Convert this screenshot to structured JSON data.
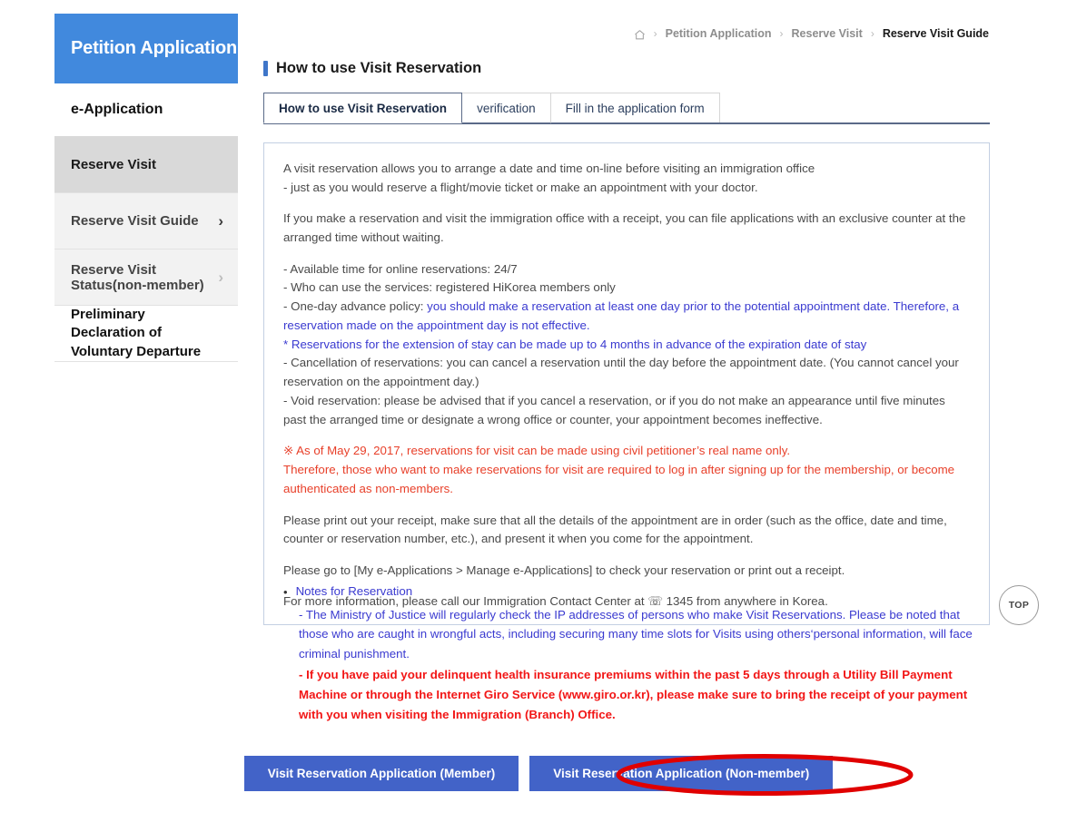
{
  "sidebar": {
    "header_title": "Petition Application",
    "section_title": "e-Application",
    "items": [
      {
        "label": "Reserve Visit",
        "chevron": ""
      },
      {
        "label": "Reserve Visit Guide",
        "chevron": "›"
      },
      {
        "label": "Reserve Visit Status(non-member)",
        "chevron": "›"
      },
      {
        "label": "Preliminary Declaration of Voluntary Departure",
        "chevron": ""
      }
    ]
  },
  "breadcrumb": {
    "home_icon": "home-icon",
    "separator": "›",
    "items": [
      "Petition Application",
      "Reserve Visit",
      "Reserve Visit Guide"
    ]
  },
  "page": {
    "title": "How to use Visit Reservation"
  },
  "tabs": [
    {
      "label": "How to use Visit Reservation",
      "active": true
    },
    {
      "label": "verification",
      "active": false
    },
    {
      "label": "Fill in the application form",
      "active": false
    }
  ],
  "info_box": {
    "para1_line1": "A visit reservation allows you to arrange a date and time on-line before visiting an immigration office",
    "para1_line2": "- just as you would reserve a flight/movie ticket or make an appointment with your doctor.",
    "para2": "If you make a reservation and visit the immigration office with a receipt, you can file applications with an exclusive counter at the arranged time without waiting.",
    "bullet_available": "- Available time for online reservations: 24/7",
    "bullet_who": "- Who can use the services: registered HiKorea members only",
    "bullet_oneday_prefix": "- One-day advance policy: ",
    "bullet_oneday_blue": "you should make a reservation at least one day prior to the potential appointment date. Therefore, a reservation made on the appointment day is not effective.",
    "bullet_extension_blue": "* Reservations for the extension of stay can be made up to 4 months in advance of the expiration date of stay",
    "bullet_cancel": "- Cancellation of reservations: you can cancel a reservation until the day before the appointment date. (You cannot cancel your reservation on the appointment day.)",
    "bullet_void": "- Void reservation: please be advised that if you cancel a reservation, or if you do not make an appearance until five minutes past the arranged time or designate a wrong office or counter, your appointment becomes ineffective.",
    "red_note_line1": "※ As of May 29, 2017, reservations for visit can be made using civil petitioner’s real name only.",
    "red_note_line2": "Therefore, those who want to make reservations for visit are required to log in after signing up for the membership, or become authenticated as non-members.",
    "para_receipt": "Please print out your receipt, make sure that all the details of the appointment are in order (such as the office, date and time, counter or reservation number, etc.), and present it when you come for the appointment.",
    "para_goto": "Please go to [My e-Applications > Manage e-Applications] to check your reservation or print out a receipt.",
    "para_contact_prefix": "For more information, please call our Immigration Contact Center at ",
    "para_contact_phone_icon": "☏",
    "para_contact_suffix": " 1345 from anywhere in Korea."
  },
  "notes": {
    "bullet_glyph": "•",
    "heading": "Notes for Reservation",
    "body_blue": "- The Ministry of Justice will regularly check the IP addresses of persons who make Visit Reservations. Please be noted that those who are caught in wrongful acts, including securing many time slots for Visits using others‘personal information, will face criminal punishment.",
    "body_red": "- If you have paid your delinquent health insurance premiums within the past 5 days through a Utility Bill Payment Machine or through the Internet Giro Service (www.giro.or.kr), please make sure to bring the receipt of your payment with you when visiting the Immigration (Branch) Office."
  },
  "top_button": {
    "label": "TOP"
  },
  "actions": {
    "member_button": "Visit Reservation Application (Member)",
    "nonmember_button": "Visit Reservation Application (Non-member)"
  },
  "colors": {
    "sidebar_header_blue": "#4189dd",
    "button_blue": "#4263c8",
    "link_blue": "#3a3ad0",
    "warning_red": "#e8402a",
    "alert_red": "#f21616",
    "annotation_red": "#e00000",
    "active_item_gray": "#d9d9d9",
    "sub_item_gray": "#f2f2f2"
  }
}
